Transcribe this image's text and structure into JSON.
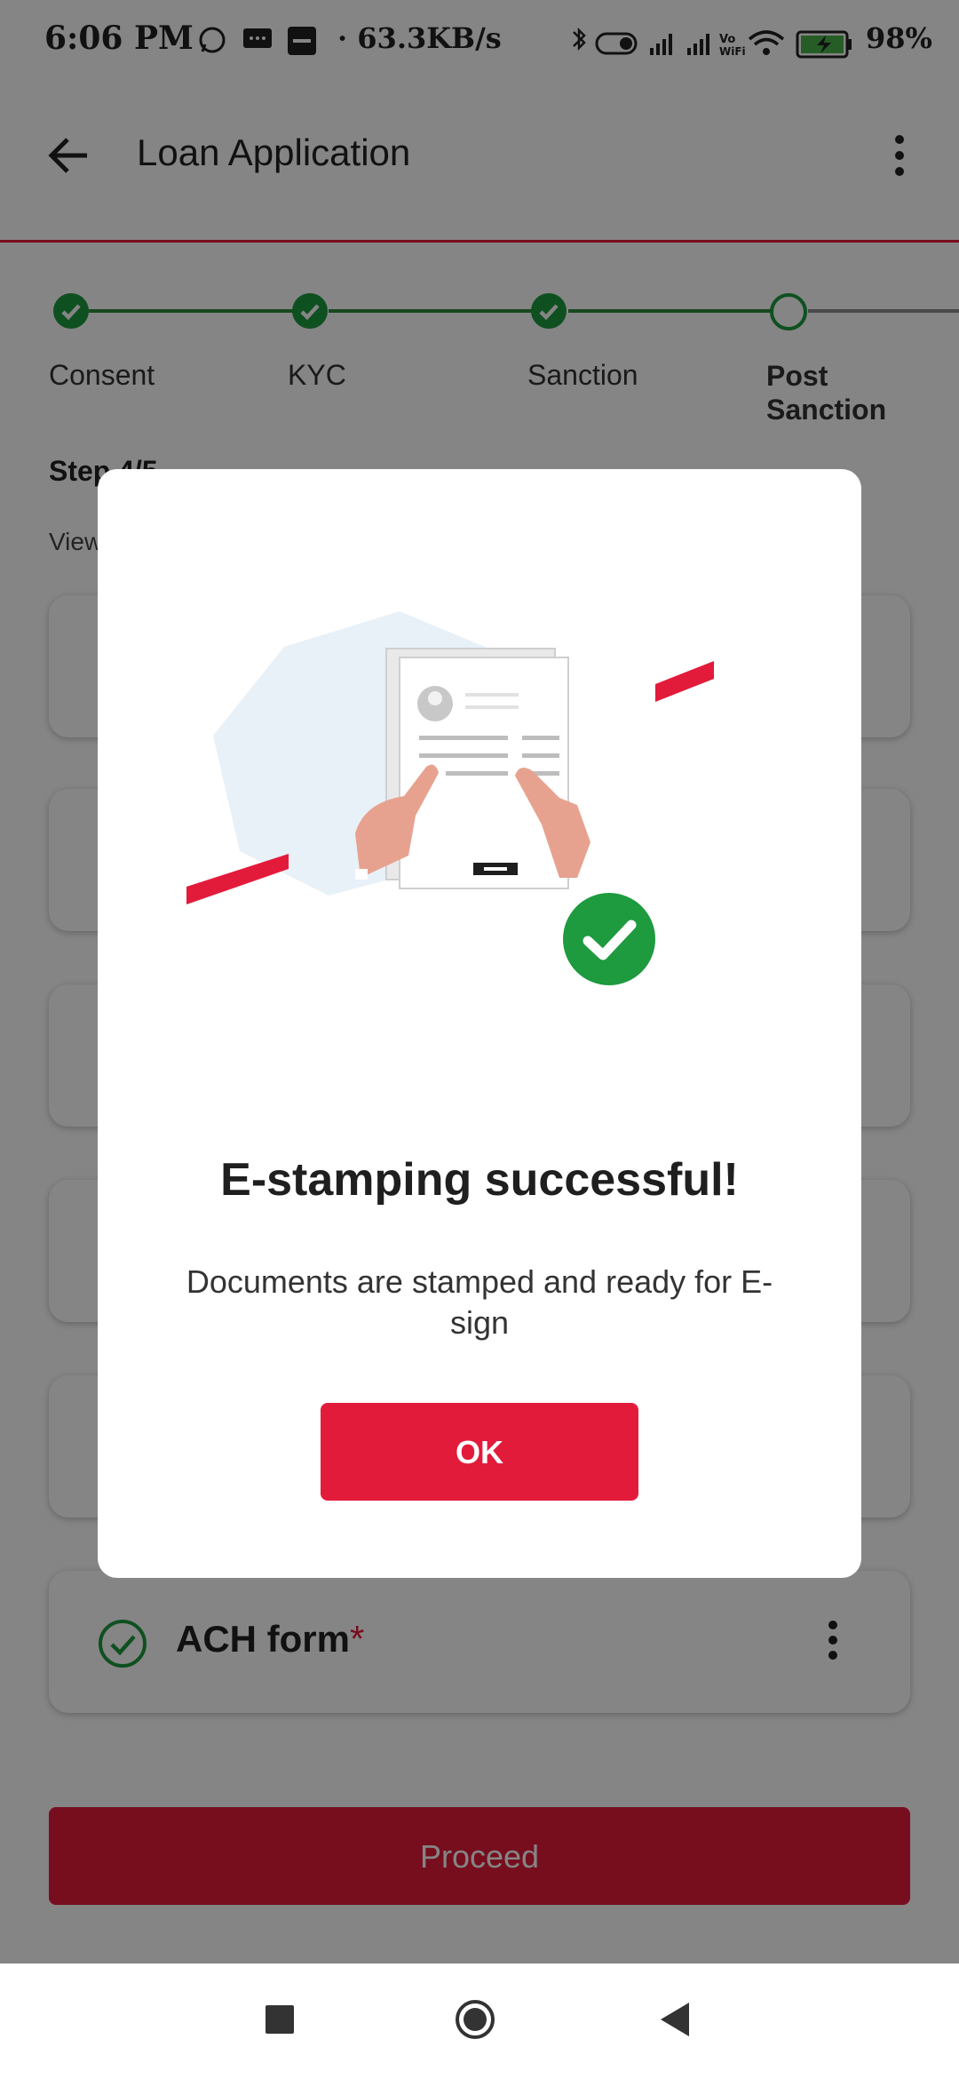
{
  "status_bar": {
    "time": "6:06 PM",
    "speed": "· 63.3KB/s",
    "battery": "98%"
  },
  "app_bar": {
    "title": "Loan Application"
  },
  "stepper": {
    "steps": [
      {
        "label": "Consent",
        "state": "done"
      },
      {
        "label": "KYC",
        "state": "done"
      },
      {
        "label": "Sanction",
        "state": "done"
      },
      {
        "label": "Post Sanction",
        "state": "current"
      }
    ],
    "step_count": "Step 4/5",
    "subtitle": "View"
  },
  "cards": [
    {
      "label": "",
      "required": false
    },
    {
      "label": "",
      "required": false
    },
    {
      "label": "",
      "required": false
    },
    {
      "label": "",
      "required": false
    },
    {
      "label": "",
      "required": false
    },
    {
      "label": "ACH form",
      "required": true,
      "required_mark": "*"
    }
  ],
  "proceed_label": "Proceed",
  "dialog": {
    "title": "E-stamping successful!",
    "message": "Documents are stamped and ready for E-sign",
    "ok_label": "OK"
  },
  "colors": {
    "accent": "#e31b3b",
    "success": "#1e9a3f"
  }
}
